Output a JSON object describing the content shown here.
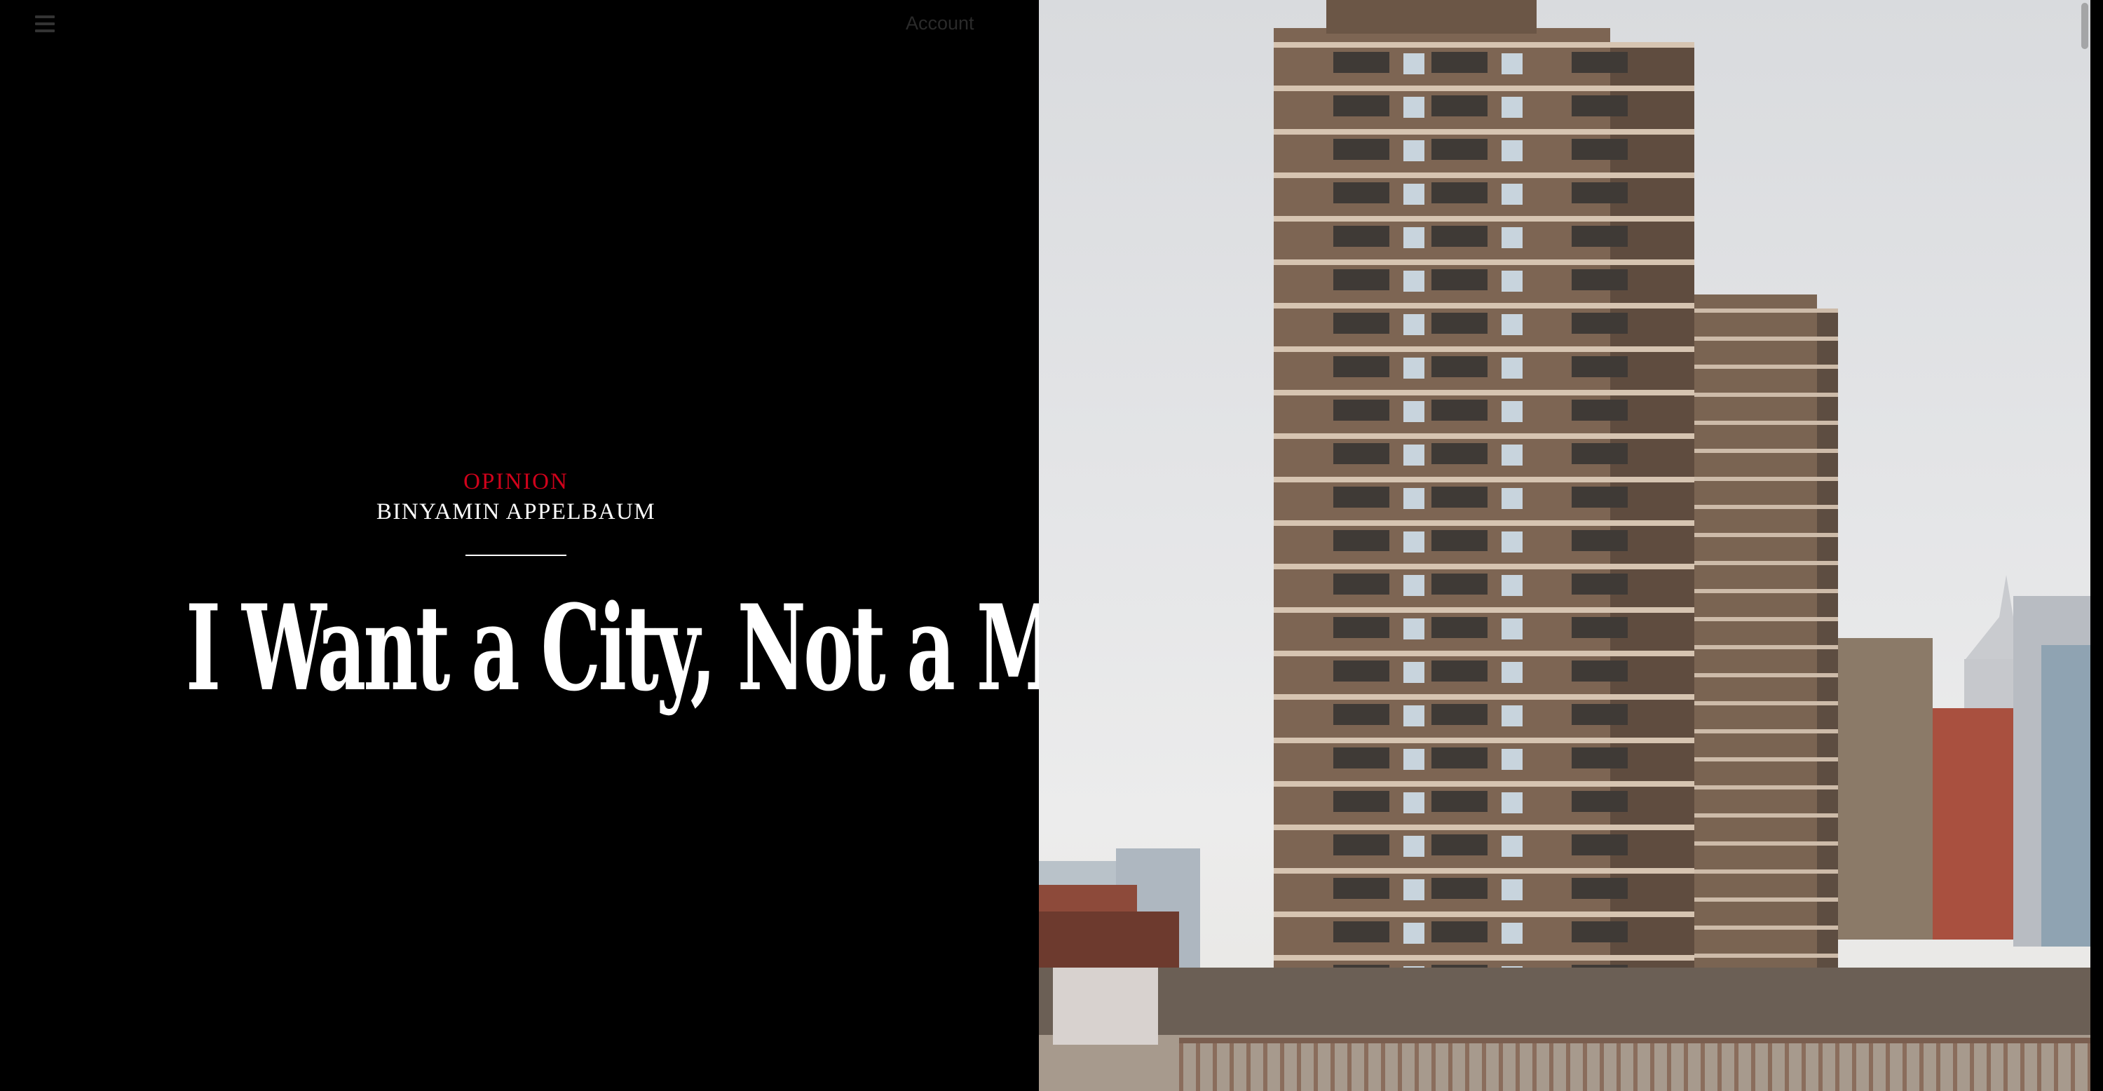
{
  "header": {
    "menu_icon": "hamburger-menu-icon",
    "account_label": "Account"
  },
  "article": {
    "kicker": "OPINION",
    "byline": "BINYAMIN APPELBAUM",
    "headline": "I Want a City, Not a Museum"
  },
  "photo": {
    "subject": "brick-residential-towers-photo"
  },
  "colors": {
    "background": "#000000",
    "kicker": "#d0021b",
    "text": "#ffffff"
  }
}
